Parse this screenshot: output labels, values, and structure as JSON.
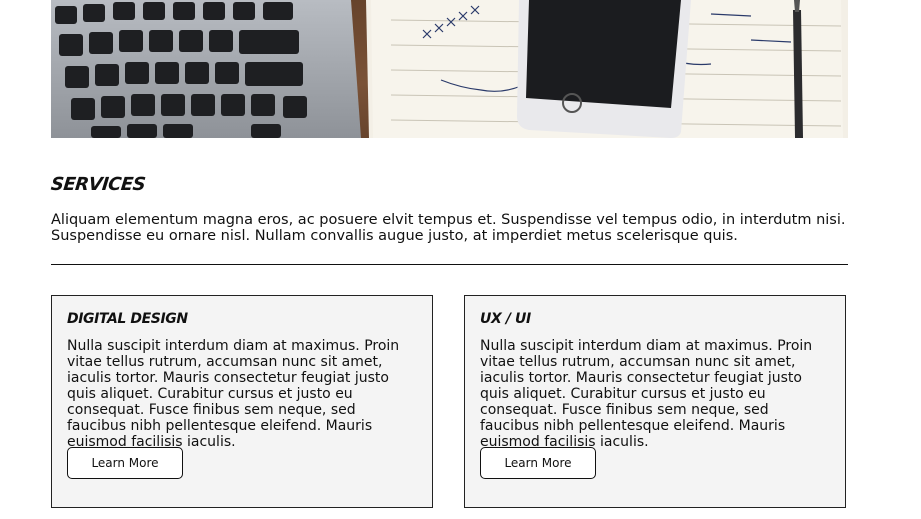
{
  "hero": {
    "image": "laptop-phone-notebook-photo"
  },
  "services": {
    "title": "Services",
    "intro": "Aliquam elementum magna eros, ac posuere elvit tempus et. Suspendisse vel tempus odio, in interdutm nisi. Suspendisse eu ornare nisl. Nullam convallis augue justo, at imperdiet metus scelerisque quis."
  },
  "cards": [
    {
      "title": "Digital Design",
      "body": "Nulla suscipit interdum diam at maximus. Proin vitae tellus rutrum, accumsan nunc sit amet, iaculis tortor. Mauris consectetur feugiat justo quis aliquet. Curabitur cursus et justo eu consequat. Fusce finibus sem neque, sed faucibus nibh pellentesque eleifend. Mauris euismod facilisis iaculis.",
      "button": "Learn More"
    },
    {
      "title": "UX / UI",
      "body": "Nulla suscipit interdum diam at maximus. Proin vitae tellus rutrum, accumsan nunc sit amet, iaculis tortor. Mauris consectetur feugiat justo quis aliquet. Curabitur cursus et justo eu consequat. Fusce finibus sem neque, sed faucibus nibh pellentesque eleifend. Mauris euismod facilisis iaculis.",
      "button": "Learn More"
    }
  ],
  "colors": {
    "background": "#ffffff",
    "card_bg": "#f4f4f4",
    "text": "#111111",
    "border": "#222222"
  }
}
